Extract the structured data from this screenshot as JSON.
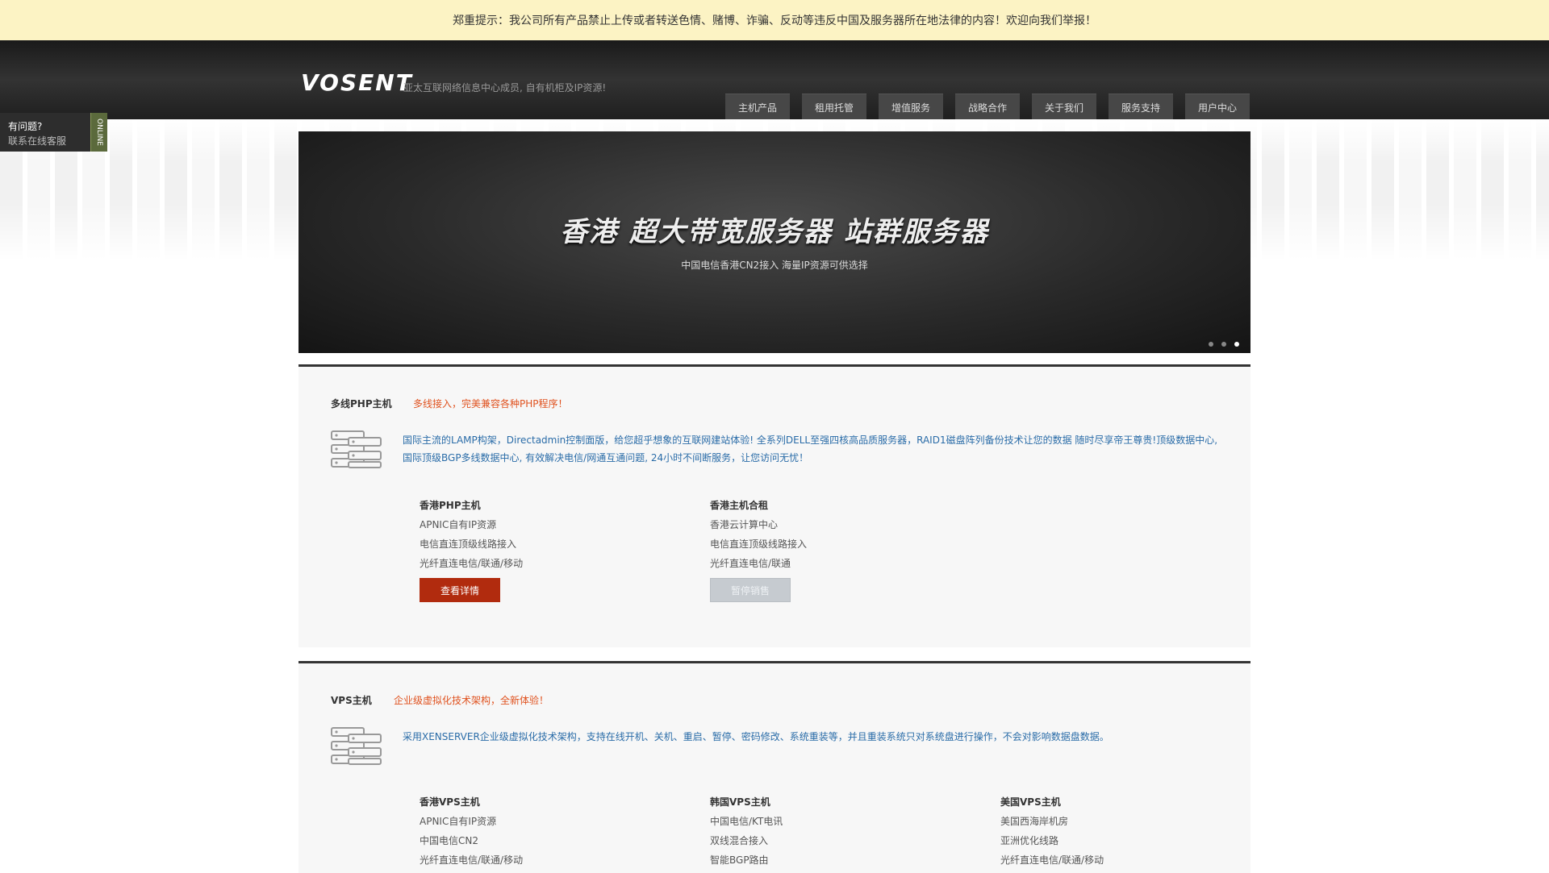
{
  "notice": {
    "text": "郑重提示：我公司所有产品禁止上传或者转送色情、赌博、诈骗、反动等违反中国及服务器所在地法律的内容！欢迎向我们举报！"
  },
  "header": {
    "logo": "VOSENT",
    "slogan": "亚太互联网络信息中心成员, 自有机柜及IP资源!",
    "nav": [
      "主机产品",
      "租用托管",
      "增值服务",
      "战略合作",
      "关于我们",
      "服务支持",
      "用户中心"
    ]
  },
  "chat": {
    "question": "有问题?",
    "service": "联系在线客服",
    "tag": "ONLINE"
  },
  "banner": {
    "title": "香港  超大带宽服务器  站群服务器",
    "subtitle": "中国电信香港CN2接入    海量IP资源可供选择",
    "slides": 3,
    "active_slide": 3
  },
  "sections": [
    {
      "title": "多线PHP主机",
      "tagline": "多线接入，完美兼容各种PHP程序！",
      "desc": [
        "国际主流的LAMP构架，Directadmin控制面版，给您超乎想象的互联网建站体验! 全系列DELL至强四核高品质服务器，RAID1磁盘阵列备份技术让您的数据 随时尽享帝王尊贵!顶级数据中心,",
        "国际顶级BGP多线数据中心, 有效解决电信/网通互通问题, 24小时不间断服务，让您访问无忧！"
      ],
      "products": [
        {
          "name": "香港PHP主机",
          "lines": [
            "APNIC自有IP资源",
            "电信直连顶级线路接入",
            "光纤直连电信/联通/移动"
          ],
          "button": "查看详情",
          "button_style": "red"
        },
        {
          "name": "香港主机合租",
          "lines": [
            "香港云计算中心",
            "电信直连顶级线路接入",
            "光纤直连电信/联通"
          ],
          "button": "暂停销售",
          "button_style": "gray"
        }
      ]
    },
    {
      "title": "VPS主机",
      "tagline": "企业级虚拟化技术架构，全新体验！",
      "desc": [
        "采用XENSERVER企业级虚拟化技术架构，支持在线开机、关机、重启、暂停、密码修改、系统重装等，并且重装系统只对系统盘进行操作，不会对影响数据盘数据。"
      ],
      "products": [
        {
          "name": "香港VPS主机",
          "lines": [
            "APNIC自有IP资源",
            "中国电信CN2",
            "光纤直连电信/联通/移动"
          ]
        },
        {
          "name": "韩国VPS主机",
          "lines": [
            "中国电信/KT电讯",
            "双线混合接入",
            "智能BGP路由"
          ]
        },
        {
          "name": "美国VPS主机",
          "lines": [
            "美国西海岸机房",
            "亚洲优化线路",
            "光纤直连电信/联通/移动"
          ]
        }
      ]
    }
  ]
}
